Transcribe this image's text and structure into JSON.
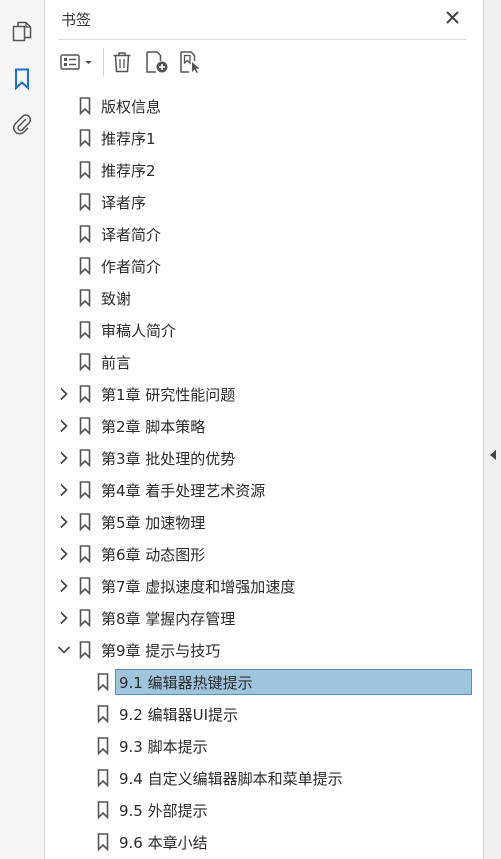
{
  "panel": {
    "title": "书签"
  },
  "bookmarks": [
    {
      "label": "版权信息"
    },
    {
      "label": "推荐序1"
    },
    {
      "label": "推荐序2"
    },
    {
      "label": "译者序"
    },
    {
      "label": "译者简介"
    },
    {
      "label": "作者简介"
    },
    {
      "label": "致谢"
    },
    {
      "label": "审稿人简介"
    },
    {
      "label": "前言"
    },
    {
      "label": "第1章 研究性能问题",
      "expandable": true
    },
    {
      "label": "第2章 脚本策略",
      "expandable": true
    },
    {
      "label": "第3章 批处理的优势",
      "expandable": true
    },
    {
      "label": "第4章 着手处理艺术资源",
      "expandable": true
    },
    {
      "label": "第5章 加速物理",
      "expandable": true
    },
    {
      "label": "第6章 动态图形",
      "expandable": true
    },
    {
      "label": "第7章 虚拟速度和增强加速度",
      "expandable": true
    },
    {
      "label": "第8章 掌握内存管理",
      "expandable": true
    },
    {
      "label": "第9章 提示与技巧",
      "expandable": true,
      "expanded": true
    },
    {
      "label": "9.1 编辑器热键提示",
      "child": true,
      "selected": true
    },
    {
      "label": "9.2 编辑器UI提示",
      "child": true
    },
    {
      "label": "9.3 脚本提示",
      "child": true
    },
    {
      "label": "9.4 自定义编辑器脚本和菜单提示",
      "child": true
    },
    {
      "label": "9.5 外部提示",
      "child": true
    },
    {
      "label": "9.6 本章小结",
      "child": true
    }
  ],
  "colors": {
    "selection": "#9fc4dd",
    "selection_border": "#5d8fb8",
    "accent": "#1a73c9"
  }
}
